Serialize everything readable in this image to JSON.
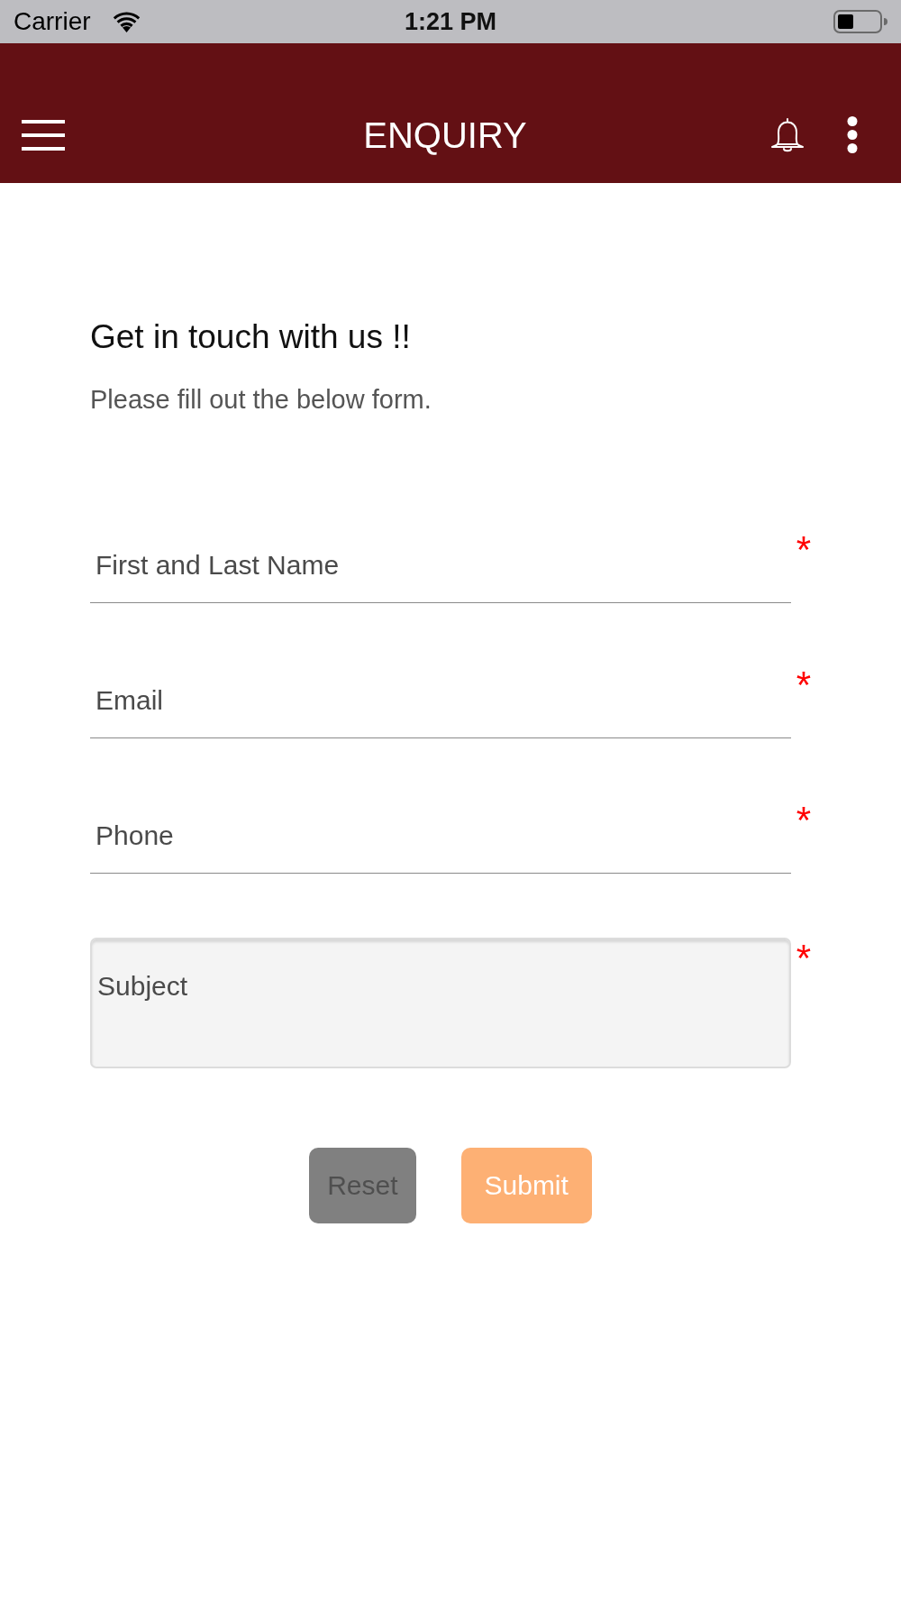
{
  "status_bar": {
    "carrier": "Carrier",
    "time": "1:21 PM"
  },
  "header": {
    "title": "ENQUIRY"
  },
  "intro": {
    "heading": "Get in touch with us !!",
    "subheading": "Please fill out the below form."
  },
  "fields": [
    {
      "kind": "line",
      "placeholder": "First and Last Name",
      "required_mark": "*"
    },
    {
      "kind": "line",
      "placeholder": "Email",
      "required_mark": "*"
    },
    {
      "kind": "line",
      "placeholder": "Phone",
      "required_mark": "*"
    },
    {
      "kind": "textarea",
      "placeholder": "Subject",
      "required_mark": "*"
    }
  ],
  "buttons": [
    {
      "kind": "reset",
      "label": "Reset"
    },
    {
      "kind": "submit",
      "label": "Submit"
    }
  ]
}
